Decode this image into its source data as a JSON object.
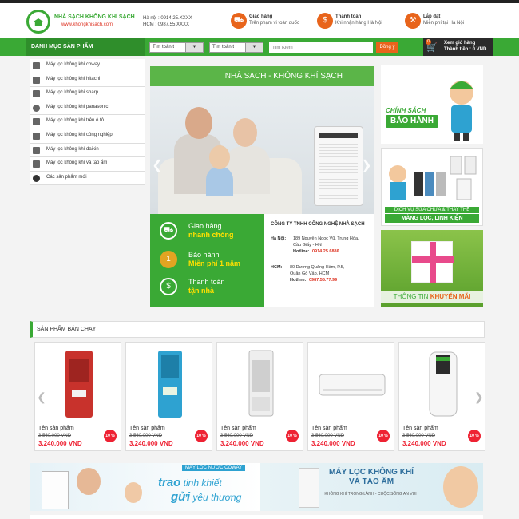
{
  "header": {
    "logo_name": "NHÀ SẠCH KHÔNG KHÍ SẠCH",
    "logo_url": "www.khongkhisach.com",
    "hotline_hn": "Hà nội : 0914.25.XXXX",
    "hotline_hcm": "HCM : 0987.55.XXXX",
    "features": [
      {
        "title": "Giao hàng",
        "sub": "Trên phạm vi toàn quốc",
        "icon": "truck-icon"
      },
      {
        "title": "Thanh toán",
        "sub": "Khi nhận hàng Hà Nội",
        "icon": "money-icon"
      },
      {
        "title": "Lắp đặt",
        "sub": "Miễn phí tại Hà Nội",
        "icon": "wrench-icon"
      }
    ]
  },
  "nav": {
    "category_label": "DANH MỤC SẢN PHẨM",
    "select1": "Tìm toàn t",
    "select2": "Tìm toàn t",
    "search_placeholder": "Tìm Kiếm",
    "search_button": "Đồng ý",
    "cart_count": "0",
    "cart_line1": "Xem giỏ hàng",
    "cart_line2": "Thành tiền : 0 VND"
  },
  "sidebar": {
    "items": [
      {
        "label": "Máy lọc không khí coway"
      },
      {
        "label": "Máy lọc không khí hitachi"
      },
      {
        "label": "Máy lọc không khí sharp"
      },
      {
        "label": "Máy lọc không khí panasonic"
      },
      {
        "label": "Máy lọc không khí trên ô tô"
      },
      {
        "label": "Máy lọc không khí công nghiệp"
      },
      {
        "label": "Máy lọc không khí daikin"
      },
      {
        "label": "Máy lọc không khí và tạo ẩm"
      },
      {
        "label": "Các sản phẩm mới"
      }
    ]
  },
  "banner": {
    "headline": "NHÀ SẠCH - KHÔNG KHÍ SẠCH",
    "services": [
      {
        "line1": "Giao hàng",
        "line2": "nhanh chóng",
        "icon": "delivery-icon"
      },
      {
        "line1": "Bảo hành",
        "line2": "Miễn phí 1 năm",
        "icon": "warranty-medal-icon"
      },
      {
        "line1": "Thanh toán",
        "line2": "tận nhà",
        "icon": "payment-icon"
      }
    ],
    "company": "CÔNG TY TNHH CÔNG NGHỆ NHÀ SẠCH",
    "hn_label": "Hà Nội:",
    "hn_addr1": "189 Nguyễn Ngọc Vũ, Trung Hòa,",
    "hn_addr2": "Cầu Giấy - HN",
    "hn_hotline_label": "Hotline:",
    "hn_hotline": "0914.25.6886",
    "hcm_label": "HCM:",
    "hcm_addr1": "80 Dương Quảng Hàm, P.5,",
    "hcm_addr2": "Quận Gò Vấp, HCM",
    "hcm_hotline_label": "Hotline:",
    "hcm_hotline": "0987.55.77.99"
  },
  "ads": {
    "warranty_t1": "CHÍNH SÁCH",
    "warranty_t2": "BẢO HÀNH",
    "repair_t1": "DỊCH VỤ SỬA CHỮA & THAY THẾ",
    "repair_t2": "MÀNG LỌC, LINH KIỆN",
    "promo_t1": "THÔNG TIN",
    "promo_t2": "KHUYẾN MÃI"
  },
  "best_sellers": {
    "title": "SẢN PHẨM BÁN CHẠY",
    "products": [
      {
        "name": "Tên sản phẩm",
        "old_price": "3.560.000 VND",
        "price": "3.240.000 VND",
        "badge": "10 %",
        "color": "#c8322c"
      },
      {
        "name": "Tên sản phẩm",
        "old_price": "3.560.000 VND",
        "price": "3.240.000 VND",
        "badge": "10 %",
        "color": "#2ea2d1"
      },
      {
        "name": "Tên sản phẩm",
        "old_price": "3.560.000 VND",
        "price": "3.240.000 VND",
        "badge": "10 %",
        "color": "#e8e8e8"
      },
      {
        "name": "Tên sản phẩm",
        "old_price": "3.560.000 VND",
        "price": "3.240.000 VND",
        "badge": "10 %",
        "color": "#f4f4f4"
      },
      {
        "name": "Tên sản phẩm",
        "old_price": "3.560.000 VND",
        "price": "3.240.000 VND",
        "badge": "10 %",
        "color": "#f2f2f2"
      }
    ]
  },
  "promo": {
    "coway": "MÁY LỌC NƯỚC COWAY",
    "t1_big": "trao",
    "t1_rest": " tinh khiết",
    "t2_big": "gửi",
    "t2_rest": " yêu thương",
    "r_title1": "MÁY LỌC KHÔNG KHÍ",
    "r_title2": "VÀ TẠO ẨM",
    "r_sub": "KHÔNG KHÍ TRONG LÀNH - CUỘC SỐNG AN VUI"
  },
  "colors": {
    "brand_green": "#3aa935",
    "accent_orange": "#e8641b",
    "price_red": "#e22233"
  }
}
